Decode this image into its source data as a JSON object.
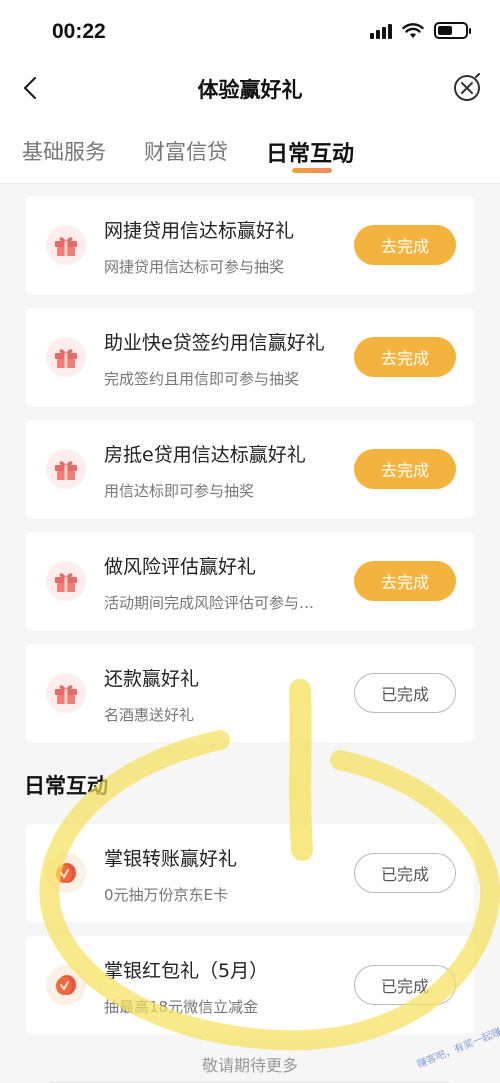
{
  "status_bar": {
    "time": "00:22"
  },
  "nav": {
    "title": "体验赢好礼"
  },
  "tabs": [
    {
      "label": "基础服务",
      "active": false
    },
    {
      "label": "财富信贷",
      "active": false
    },
    {
      "label": "日常互动",
      "active": true
    }
  ],
  "loan_tasks": [
    {
      "title": "网捷贷用信达标赢好礼",
      "subtitle": "网捷贷用信达标可参与抽奖",
      "button": "去完成",
      "status": "todo",
      "icon": "gift-icon"
    },
    {
      "title": "助业快e贷签约用信赢好礼",
      "subtitle": "完成签约且用信即可参与抽奖",
      "button": "去完成",
      "status": "todo",
      "icon": "gift-icon"
    },
    {
      "title": "房抵e贷用信达标赢好礼",
      "subtitle": "用信达标即可参与抽奖",
      "button": "去完成",
      "status": "todo",
      "icon": "gift-icon"
    },
    {
      "title": "做风险评估赢好礼",
      "subtitle": "活动期间完成风险评估可参与…",
      "button": "去完成",
      "status": "todo",
      "icon": "gift-icon"
    },
    {
      "title": "还款赢好礼",
      "subtitle": "名酒惠送好礼",
      "button": "已完成",
      "status": "done",
      "icon": "gift-icon"
    }
  ],
  "daily_section": {
    "title": "日常互动"
  },
  "daily_tasks": [
    {
      "title": "掌银转账赢好礼",
      "subtitle": "0元抽万份京东E卡",
      "button": "已完成",
      "status": "done",
      "icon": "coin-icon"
    },
    {
      "title": "掌银红包礼（5月）",
      "subtitle": "抽最高18元微信立减金",
      "button": "已完成",
      "status": "done",
      "icon": "coin-icon"
    }
  ],
  "footer": {
    "text": "敬请期待更多"
  },
  "watermark": "赚客吧，有奖一起赚！www.zuanke8.com",
  "colors": {
    "accent_button": "#f2b33f",
    "tab_underline": "#ef8a5a",
    "highlight": "#f5e05a"
  }
}
